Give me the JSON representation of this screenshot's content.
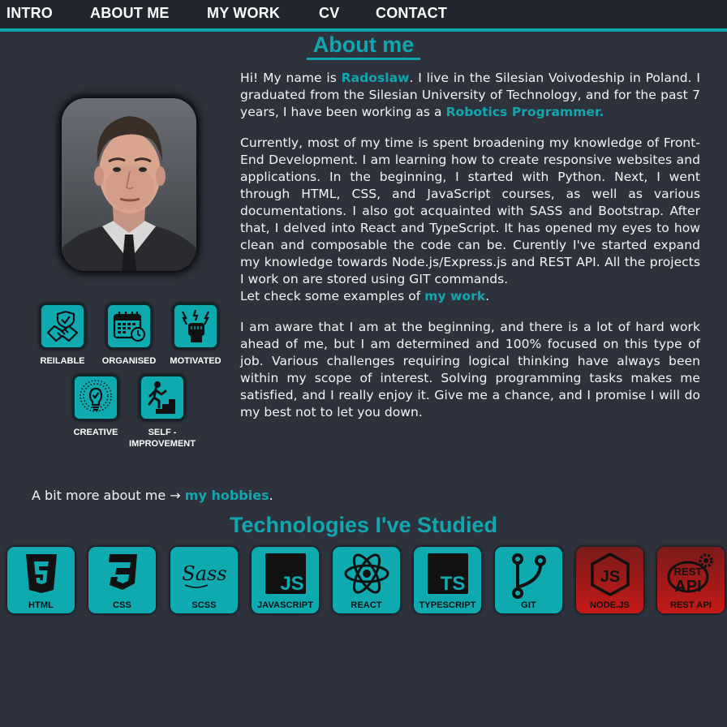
{
  "nav": {
    "items": [
      "INTRO",
      "ABOUT ME",
      "MY WORK",
      "CV",
      "CONTACT"
    ]
  },
  "about": {
    "title": "About me",
    "p1": {
      "t1": "Hi! My name is ",
      "name": "Radoslaw",
      "t2": ". I live in the Silesian Voivodeship in Poland. I graduated from the Silesian University of Technology, and for the past 7 years, I have been working as a ",
      "role": "Robotics Programmer."
    },
    "p2": "Currently, most of my time is spent broadening my knowledge of Front-End Development. I am learning how to create responsive websites and applications. In the beginning, I started with Python. Next, I went through HTML, CSS, and JavaScript courses, as well as various documentations. I also got acquainted with SASS and Bootstrap. After that, I delved into React and TypeScript. It has opened my eyes to how clean and composable the code can be. Curently I've started expand my knowledge towards Node.js/Express.js and REST API. All the projects I work on are stored using GIT commands.",
    "p3": {
      "t1": "Let check some examples of ",
      "link": "my work",
      "t2": "."
    },
    "p4": "I am aware that I am at the beginning, and there is a lot of hard work ahead of me, but I am determined and 100% focused on this type of job. Various challenges requiring logical thinking have always been within my scope of interest. Solving programming tasks makes me satisfied, and I really enjoy it. Give me a chance, and I promise I will do my best not to let you down.",
    "hobbies": {
      "t1": "A bit more about me → ",
      "link": "my hobbies",
      "t2": "."
    }
  },
  "traits": [
    {
      "label": "REILABLE",
      "icon": "handshake-shield-icon"
    },
    {
      "label": "ORGANISED",
      "icon": "calendar-clock-icon"
    },
    {
      "label": "MOTIVATED",
      "icon": "fist-lightning-icon"
    },
    {
      "label": "CREATIVE",
      "icon": "lightbulb-check-icon"
    },
    {
      "label": "SELF -\nIMPROVEMENT",
      "icon": "climbing-stairs-icon"
    }
  ],
  "technologies": {
    "title": "Technologies I've Studied",
    "items": [
      {
        "label": "HTML",
        "icon": "html5-icon",
        "studied": true
      },
      {
        "label": "CSS",
        "icon": "css3-icon",
        "studied": true
      },
      {
        "label": "SCSS",
        "icon": "sass-icon",
        "studied": true
      },
      {
        "label": "JAVASCRIPT",
        "icon": "javascript-icon",
        "studied": true
      },
      {
        "label": "REACT",
        "icon": "react-icon",
        "studied": true
      },
      {
        "label": "TYPESCRIPT",
        "icon": "typescript-icon",
        "studied": true
      },
      {
        "label": "GIT",
        "icon": "git-branch-icon",
        "studied": true
      },
      {
        "label": "NODE.JS",
        "icon": "nodejs-icon",
        "studied": false
      },
      {
        "label": "REST API",
        "icon": "rest-api-icon",
        "studied": false
      }
    ],
    "icon_text": {
      "js": "JS",
      "ts": "TS",
      "sass": "Sass",
      "rest": "REST",
      "api": "API"
    }
  },
  "colors": {
    "accent": "#12a6ae",
    "background": "#2d323c",
    "nav": "#21252d",
    "learning": "#c41a17"
  }
}
